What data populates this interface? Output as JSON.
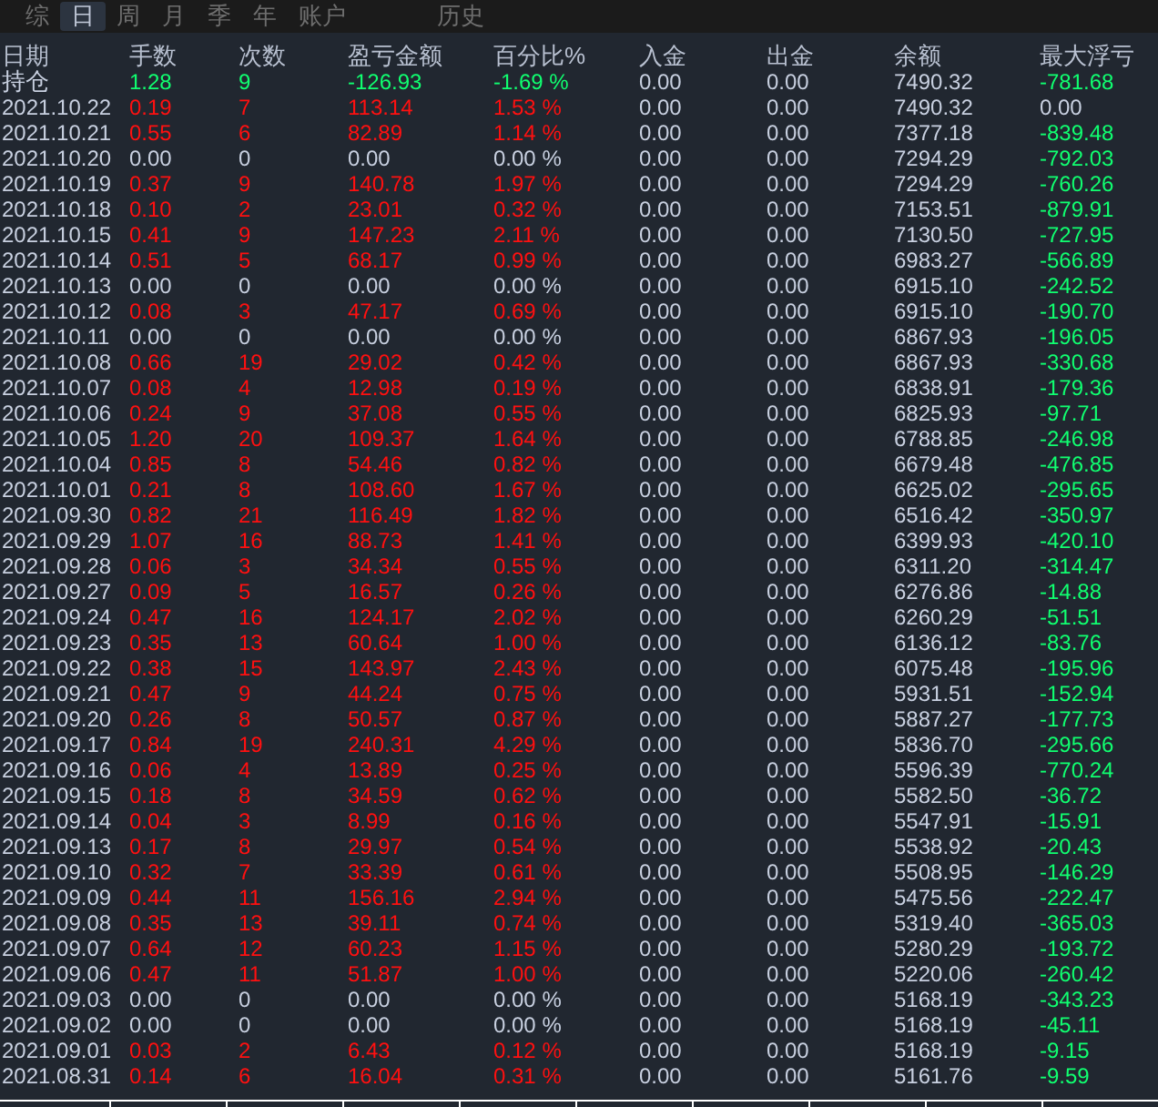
{
  "tabs": [
    {
      "label": "综",
      "selected": false
    },
    {
      "label": "日",
      "selected": true
    },
    {
      "label": "周",
      "selected": false
    },
    {
      "label": "月",
      "selected": false
    },
    {
      "label": "季",
      "selected": false
    },
    {
      "label": "年",
      "selected": false
    },
    {
      "label": "账户",
      "selected": false
    },
    {
      "label": "历史",
      "selected": false
    }
  ],
  "columns": [
    "日期",
    "手数",
    "次数",
    "盈亏金额",
    "百分比%",
    "入金",
    "出金",
    "余额",
    "最大浮亏"
  ],
  "rows": [
    {
      "date": "持仓",
      "lots": "1.28",
      "trades": "9",
      "pnl": "-126.93",
      "pct": "-1.69 %",
      "deposit": "0.00",
      "withdraw": "0.00",
      "balance": "7490.32",
      "drawdown": {
        "text": "-781.68",
        "color": "#10ff70"
      },
      "color": "#10ff70"
    },
    {
      "date": "2021.10.22",
      "lots": "0.19",
      "trades": "7",
      "pnl": "113.14",
      "pct": "1.53 %",
      "deposit": "0.00",
      "withdraw": "0.00",
      "balance": "7490.32",
      "drawdown": {
        "text": "0.00",
        "color": "#c8d0e0"
      },
      "color": "#ff1010"
    },
    {
      "date": "2021.10.21",
      "lots": "0.55",
      "trades": "6",
      "pnl": "82.89",
      "pct": "1.14 %",
      "deposit": "0.00",
      "withdraw": "0.00",
      "balance": "7377.18",
      "drawdown": {
        "text": "-839.48",
        "color": "#10ff70"
      },
      "color": "#ff1010"
    },
    {
      "date": "2021.10.20",
      "lots": "0.00",
      "trades": "0",
      "pnl": "0.00",
      "pct": "0.00 %",
      "deposit": "0.00",
      "withdraw": "0.00",
      "balance": "7294.29",
      "drawdown": {
        "text": "-792.03",
        "color": "#10ff70"
      },
      "color": "#c8d0e0"
    },
    {
      "date": "2021.10.19",
      "lots": "0.37",
      "trades": "9",
      "pnl": "140.78",
      "pct": "1.97 %",
      "deposit": "0.00",
      "withdraw": "0.00",
      "balance": "7294.29",
      "drawdown": {
        "text": "-760.26",
        "color": "#10ff70"
      },
      "color": "#ff1010"
    },
    {
      "date": "2021.10.18",
      "lots": "0.10",
      "trades": "2",
      "pnl": "23.01",
      "pct": "0.32 %",
      "deposit": "0.00",
      "withdraw": "0.00",
      "balance": "7153.51",
      "drawdown": {
        "text": "-879.91",
        "color": "#10ff70"
      },
      "color": "#ff1010"
    },
    {
      "date": "2021.10.15",
      "lots": "0.41",
      "trades": "9",
      "pnl": "147.23",
      "pct": "2.11 %",
      "deposit": "0.00",
      "withdraw": "0.00",
      "balance": "7130.50",
      "drawdown": {
        "text": "-727.95",
        "color": "#10ff70"
      },
      "color": "#ff1010"
    },
    {
      "date": "2021.10.14",
      "lots": "0.51",
      "trades": "5",
      "pnl": "68.17",
      "pct": "0.99 %",
      "deposit": "0.00",
      "withdraw": "0.00",
      "balance": "6983.27",
      "drawdown": {
        "text": "-566.89",
        "color": "#10ff70"
      },
      "color": "#ff1010"
    },
    {
      "date": "2021.10.13",
      "lots": "0.00",
      "trades": "0",
      "pnl": "0.00",
      "pct": "0.00 %",
      "deposit": "0.00",
      "withdraw": "0.00",
      "balance": "6915.10",
      "drawdown": {
        "text": "-242.52",
        "color": "#10ff70"
      },
      "color": "#c8d0e0"
    },
    {
      "date": "2021.10.12",
      "lots": "0.08",
      "trades": "3",
      "pnl": "47.17",
      "pct": "0.69 %",
      "deposit": "0.00",
      "withdraw": "0.00",
      "balance": "6915.10",
      "drawdown": {
        "text": "-190.70",
        "color": "#10ff70"
      },
      "color": "#ff1010"
    },
    {
      "date": "2021.10.11",
      "lots": "0.00",
      "trades": "0",
      "pnl": "0.00",
      "pct": "0.00 %",
      "deposit": "0.00",
      "withdraw": "0.00",
      "balance": "6867.93",
      "drawdown": {
        "text": "-196.05",
        "color": "#10ff70"
      },
      "color": "#c8d0e0"
    },
    {
      "date": "2021.10.08",
      "lots": "0.66",
      "trades": "19",
      "pnl": "29.02",
      "pct": "0.42 %",
      "deposit": "0.00",
      "withdraw": "0.00",
      "balance": "6867.93",
      "drawdown": {
        "text": "-330.68",
        "color": "#10ff70"
      },
      "color": "#ff1010"
    },
    {
      "date": "2021.10.07",
      "lots": "0.08",
      "trades": "4",
      "pnl": "12.98",
      "pct": "0.19 %",
      "deposit": "0.00",
      "withdraw": "0.00",
      "balance": "6838.91",
      "drawdown": {
        "text": "-179.36",
        "color": "#10ff70"
      },
      "color": "#ff1010"
    },
    {
      "date": "2021.10.06",
      "lots": "0.24",
      "trades": "9",
      "pnl": "37.08",
      "pct": "0.55 %",
      "deposit": "0.00",
      "withdraw": "0.00",
      "balance": "6825.93",
      "drawdown": {
        "text": "-97.71",
        "color": "#10ff70"
      },
      "color": "#ff1010"
    },
    {
      "date": "2021.10.05",
      "lots": "1.20",
      "trades": "20",
      "pnl": "109.37",
      "pct": "1.64 %",
      "deposit": "0.00",
      "withdraw": "0.00",
      "balance": "6788.85",
      "drawdown": {
        "text": "-246.98",
        "color": "#10ff70"
      },
      "color": "#ff1010"
    },
    {
      "date": "2021.10.04",
      "lots": "0.85",
      "trades": "8",
      "pnl": "54.46",
      "pct": "0.82 %",
      "deposit": "0.00",
      "withdraw": "0.00",
      "balance": "6679.48",
      "drawdown": {
        "text": "-476.85",
        "color": "#10ff70"
      },
      "color": "#ff1010"
    },
    {
      "date": "2021.10.01",
      "lots": "0.21",
      "trades": "8",
      "pnl": "108.60",
      "pct": "1.67 %",
      "deposit": "0.00",
      "withdraw": "0.00",
      "balance": "6625.02",
      "drawdown": {
        "text": "-295.65",
        "color": "#10ff70"
      },
      "color": "#ff1010"
    },
    {
      "date": "2021.09.30",
      "lots": "0.82",
      "trades": "21",
      "pnl": "116.49",
      "pct": "1.82 %",
      "deposit": "0.00",
      "withdraw": "0.00",
      "balance": "6516.42",
      "drawdown": {
        "text": "-350.97",
        "color": "#10ff70"
      },
      "color": "#ff1010"
    },
    {
      "date": "2021.09.29",
      "lots": "1.07",
      "trades": "16",
      "pnl": "88.73",
      "pct": "1.41 %",
      "deposit": "0.00",
      "withdraw": "0.00",
      "balance": "6399.93",
      "drawdown": {
        "text": "-420.10",
        "color": "#10ff70"
      },
      "color": "#ff1010"
    },
    {
      "date": "2021.09.28",
      "lots": "0.06",
      "trades": "3",
      "pnl": "34.34",
      "pct": "0.55 %",
      "deposit": "0.00",
      "withdraw": "0.00",
      "balance": "6311.20",
      "drawdown": {
        "text": "-314.47",
        "color": "#10ff70"
      },
      "color": "#ff1010"
    },
    {
      "date": "2021.09.27",
      "lots": "0.09",
      "trades": "5",
      "pnl": "16.57",
      "pct": "0.26 %",
      "deposit": "0.00",
      "withdraw": "0.00",
      "balance": "6276.86",
      "drawdown": {
        "text": "-14.88",
        "color": "#10ff70"
      },
      "color": "#ff1010"
    },
    {
      "date": "2021.09.24",
      "lots": "0.47",
      "trades": "16",
      "pnl": "124.17",
      "pct": "2.02 %",
      "deposit": "0.00",
      "withdraw": "0.00",
      "balance": "6260.29",
      "drawdown": {
        "text": "-51.51",
        "color": "#10ff70"
      },
      "color": "#ff1010"
    },
    {
      "date": "2021.09.23",
      "lots": "0.35",
      "trades": "13",
      "pnl": "60.64",
      "pct": "1.00 %",
      "deposit": "0.00",
      "withdraw": "0.00",
      "balance": "6136.12",
      "drawdown": {
        "text": "-83.76",
        "color": "#10ff70"
      },
      "color": "#ff1010"
    },
    {
      "date": "2021.09.22",
      "lots": "0.38",
      "trades": "15",
      "pnl": "143.97",
      "pct": "2.43 %",
      "deposit": "0.00",
      "withdraw": "0.00",
      "balance": "6075.48",
      "drawdown": {
        "text": "-195.96",
        "color": "#10ff70"
      },
      "color": "#ff1010"
    },
    {
      "date": "2021.09.21",
      "lots": "0.47",
      "trades": "9",
      "pnl": "44.24",
      "pct": "0.75 %",
      "deposit": "0.00",
      "withdraw": "0.00",
      "balance": "5931.51",
      "drawdown": {
        "text": "-152.94",
        "color": "#10ff70"
      },
      "color": "#ff1010"
    },
    {
      "date": "2021.09.20",
      "lots": "0.26",
      "trades": "8",
      "pnl": "50.57",
      "pct": "0.87 %",
      "deposit": "0.00",
      "withdraw": "0.00",
      "balance": "5887.27",
      "drawdown": {
        "text": "-177.73",
        "color": "#10ff70"
      },
      "color": "#ff1010"
    },
    {
      "date": "2021.09.17",
      "lots": "0.84",
      "trades": "19",
      "pnl": "240.31",
      "pct": "4.29 %",
      "deposit": "0.00",
      "withdraw": "0.00",
      "balance": "5836.70",
      "drawdown": {
        "text": "-295.66",
        "color": "#10ff70"
      },
      "color": "#ff1010"
    },
    {
      "date": "2021.09.16",
      "lots": "0.06",
      "trades": "4",
      "pnl": "13.89",
      "pct": "0.25 %",
      "deposit": "0.00",
      "withdraw": "0.00",
      "balance": "5596.39",
      "drawdown": {
        "text": "-770.24",
        "color": "#10ff70"
      },
      "color": "#ff1010"
    },
    {
      "date": "2021.09.15",
      "lots": "0.18",
      "trades": "8",
      "pnl": "34.59",
      "pct": "0.62 %",
      "deposit": "0.00",
      "withdraw": "0.00",
      "balance": "5582.50",
      "drawdown": {
        "text": "-36.72",
        "color": "#10ff70"
      },
      "color": "#ff1010"
    },
    {
      "date": "2021.09.14",
      "lots": "0.04",
      "trades": "3",
      "pnl": "8.99",
      "pct": "0.16 %",
      "deposit": "0.00",
      "withdraw": "0.00",
      "balance": "5547.91",
      "drawdown": {
        "text": "-15.91",
        "color": "#10ff70"
      },
      "color": "#ff1010"
    },
    {
      "date": "2021.09.13",
      "lots": "0.17",
      "trades": "8",
      "pnl": "29.97",
      "pct": "0.54 %",
      "deposit": "0.00",
      "withdraw": "0.00",
      "balance": "5538.92",
      "drawdown": {
        "text": "-20.43",
        "color": "#10ff70"
      },
      "color": "#ff1010"
    },
    {
      "date": "2021.09.10",
      "lots": "0.32",
      "trades": "7",
      "pnl": "33.39",
      "pct": "0.61 %",
      "deposit": "0.00",
      "withdraw": "0.00",
      "balance": "5508.95",
      "drawdown": {
        "text": "-146.29",
        "color": "#10ff70"
      },
      "color": "#ff1010"
    },
    {
      "date": "2021.09.09",
      "lots": "0.44",
      "trades": "11",
      "pnl": "156.16",
      "pct": "2.94 %",
      "deposit": "0.00",
      "withdraw": "0.00",
      "balance": "5475.56",
      "drawdown": {
        "text": "-222.47",
        "color": "#10ff70"
      },
      "color": "#ff1010"
    },
    {
      "date": "2021.09.08",
      "lots": "0.35",
      "trades": "13",
      "pnl": "39.11",
      "pct": "0.74 %",
      "deposit": "0.00",
      "withdraw": "0.00",
      "balance": "5319.40",
      "drawdown": {
        "text": "-365.03",
        "color": "#10ff70"
      },
      "color": "#ff1010"
    },
    {
      "date": "2021.09.07",
      "lots": "0.64",
      "trades": "12",
      "pnl": "60.23",
      "pct": "1.15 %",
      "deposit": "0.00",
      "withdraw": "0.00",
      "balance": "5280.29",
      "drawdown": {
        "text": "-193.72",
        "color": "#10ff70"
      },
      "color": "#ff1010"
    },
    {
      "date": "2021.09.06",
      "lots": "0.47",
      "trades": "11",
      "pnl": "51.87",
      "pct": "1.00 %",
      "deposit": "0.00",
      "withdraw": "0.00",
      "balance": "5220.06",
      "drawdown": {
        "text": "-260.42",
        "color": "#10ff70"
      },
      "color": "#ff1010"
    },
    {
      "date": "2021.09.03",
      "lots": "0.00",
      "trades": "0",
      "pnl": "0.00",
      "pct": "0.00 %",
      "deposit": "0.00",
      "withdraw": "0.00",
      "balance": "5168.19",
      "drawdown": {
        "text": "-343.23",
        "color": "#10ff70"
      },
      "color": "#c8d0e0"
    },
    {
      "date": "2021.09.02",
      "lots": "0.00",
      "trades": "0",
      "pnl": "0.00",
      "pct": "0.00 %",
      "deposit": "0.00",
      "withdraw": "0.00",
      "balance": "5168.19",
      "drawdown": {
        "text": "-45.11",
        "color": "#10ff70"
      },
      "color": "#c8d0e0"
    },
    {
      "date": "2021.09.01",
      "lots": "0.03",
      "trades": "2",
      "pnl": "6.43",
      "pct": "0.12 %",
      "deposit": "0.00",
      "withdraw": "0.00",
      "balance": "5168.19",
      "drawdown": {
        "text": "-9.15",
        "color": "#10ff70"
      },
      "color": "#ff1010"
    },
    {
      "date": "2021.08.31",
      "lots": "0.14",
      "trades": "6",
      "pnl": "16.04",
      "pct": "0.31 %",
      "deposit": "0.00",
      "withdraw": "0.00",
      "balance": "5161.76",
      "drawdown": {
        "text": "-9.59",
        "color": "#10ff70"
      },
      "color": "#ff1010"
    }
  ]
}
